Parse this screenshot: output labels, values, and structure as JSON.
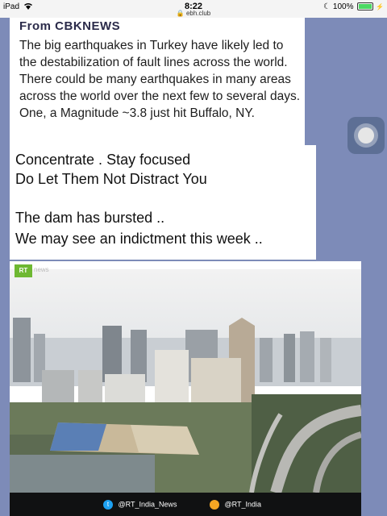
{
  "status_bar": {
    "device": "iPad",
    "time": "8:22",
    "url": "ebh.club",
    "battery": "100%",
    "battery_level": 1.0
  },
  "post1": {
    "source": "From CBKNEWS",
    "body": "The big earthquakes in Turkey have likely led to the destabilization of fault lines across the world. There could be many earthquakes in many areas across the world over the next few to several days. One, a Magnitude ~3.8 just hit Buffalo, NY."
  },
  "post2": {
    "line1": "Concentrate . Stay focused",
    "line2": "Do Let Them Not Distract You",
    "line3": "The dam has bursted ..",
    "line4": "We may see an indictment this week .."
  },
  "video": {
    "logo": "RT",
    "logo_suffix": "news",
    "twitter_handle": "@RT_India_News",
    "other_handle": "@RT_India"
  },
  "colors": {
    "page_bg": "#7d8bb8",
    "rt_green": "#6eb832",
    "twitter_blue": "#1da1f2"
  }
}
